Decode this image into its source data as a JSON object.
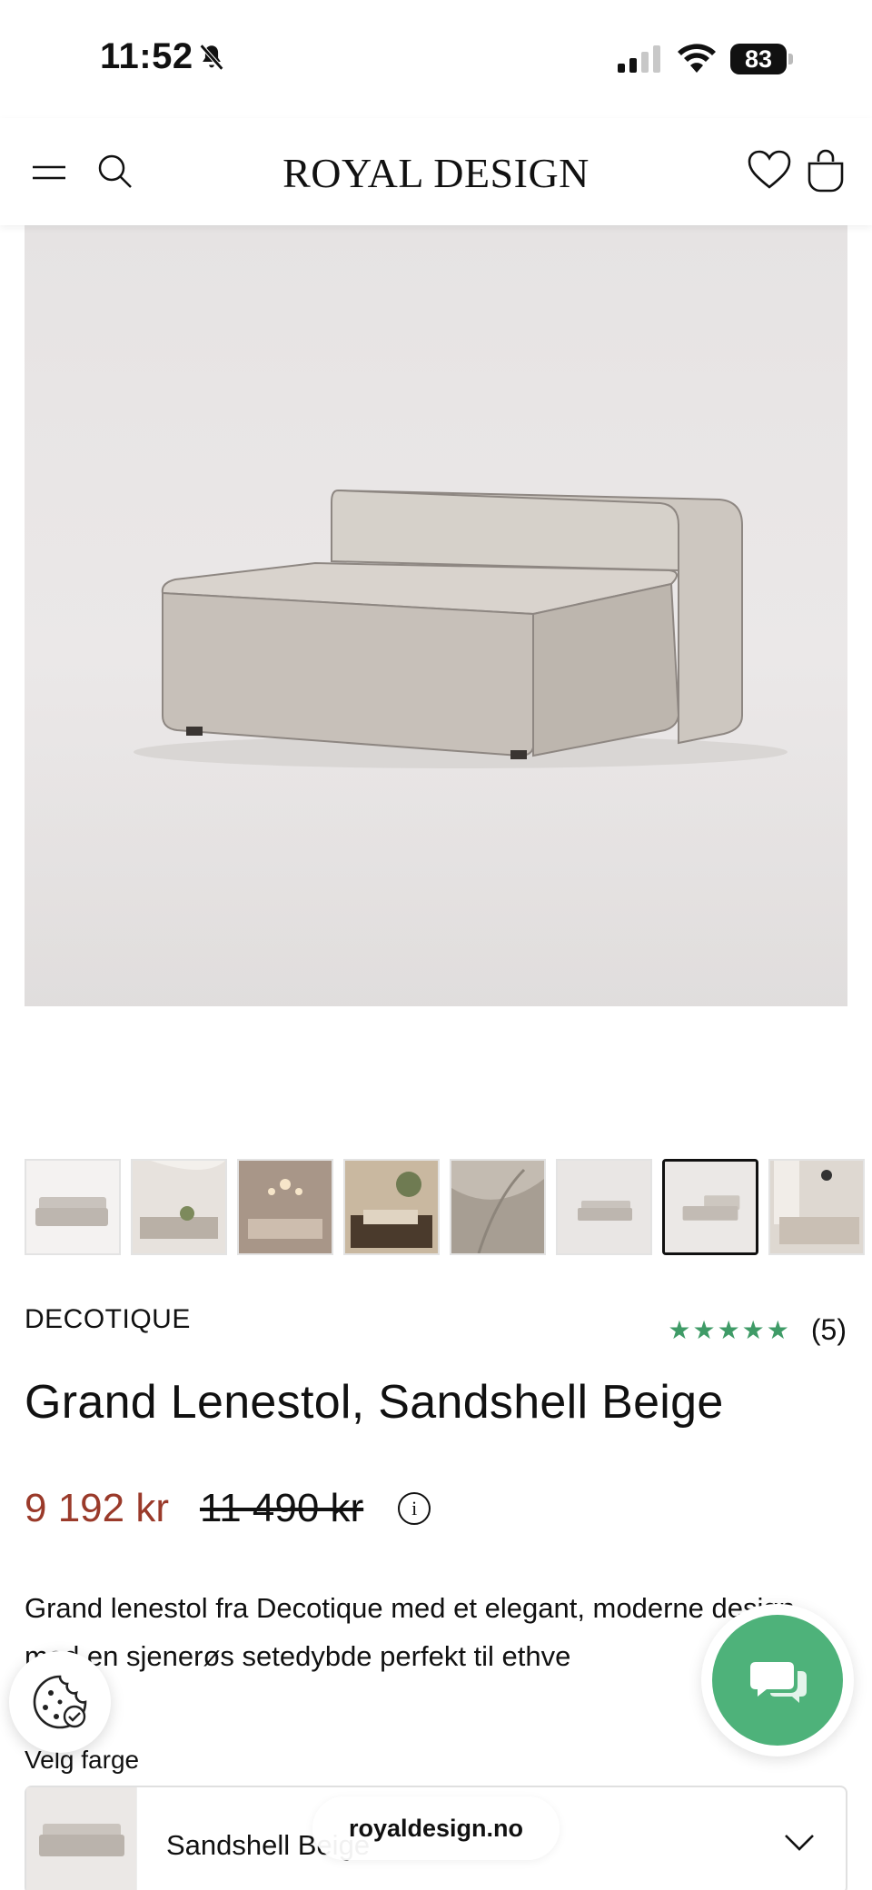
{
  "status_bar": {
    "time": "11:52",
    "battery": "83",
    "icons": [
      "bell-slash-icon",
      "signal-icon",
      "wifi-icon",
      "battery-icon"
    ]
  },
  "header": {
    "logo": "ROYAL DESIGN",
    "icons": [
      "menu-icon",
      "search-icon",
      "heart-icon",
      "bag-icon"
    ]
  },
  "product": {
    "brand": "DECOTIQUE",
    "rating_stars": "★★★★★",
    "rating_count": "(5)",
    "title": "Grand Lenestol, Sandshell Beige",
    "price_sale": "9 192 kr",
    "price_original": "11 490 kr",
    "info_glyph": "i",
    "description": "Grand lenestol fra Decotique med et elegant, moderne design med en sjenerøs setedybde perfekt til ethve",
    "thumbnails": [
      "Sofa module",
      "Room scene",
      "Living room",
      "Interior",
      "Fabric detail",
      "Sofa module",
      "Sofa module",
      "Room scene"
    ],
    "active_thumbnail_index": 6
  },
  "color_picker": {
    "label": "Velg farge",
    "selected": "Sandshell Beige"
  },
  "browser": {
    "url": "royaldesign.no"
  },
  "colors": {
    "sale_price": "#9a3a2a",
    "stars": "#3f9b67",
    "chat_button": "#4eb27a"
  }
}
